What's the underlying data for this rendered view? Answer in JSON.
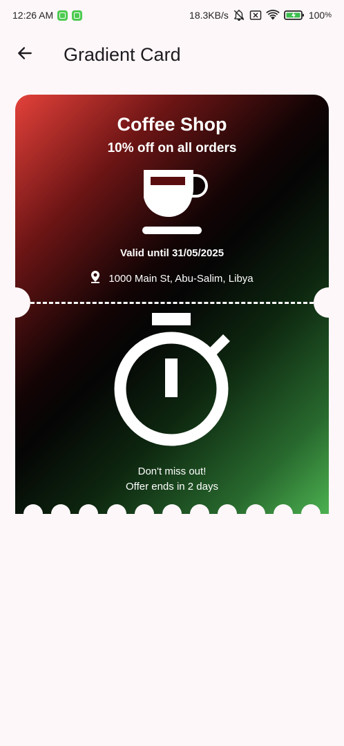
{
  "status_bar": {
    "time": "12:26 AM",
    "network_speed": "18.3KB/s",
    "battery": "100",
    "icons": [
      "app-notification-icon",
      "app-notification-icon",
      "bell-off-icon",
      "sim-x-icon",
      "wifi-icon",
      "battery-charging-icon"
    ]
  },
  "app_bar": {
    "back_icon": "arrow-left-icon",
    "title": "Gradient Card"
  },
  "card": {
    "shop_name": "Coffee Shop",
    "offer": "10% off on all orders",
    "main_icon": "coffee-cup-icon",
    "valid_until": "Valid until 31/05/2025",
    "location_icon": "location-pin-icon",
    "address": "1000 Main St, Abu-Salim, Libya",
    "timer_icon": "stopwatch-icon",
    "cta_line1": "Don't miss out!",
    "cta_line2": "Offer ends in 2 days",
    "colors": {
      "gradient_start": "#e4413a",
      "gradient_mid": "#050505",
      "gradient_end": "#4cb150"
    }
  }
}
